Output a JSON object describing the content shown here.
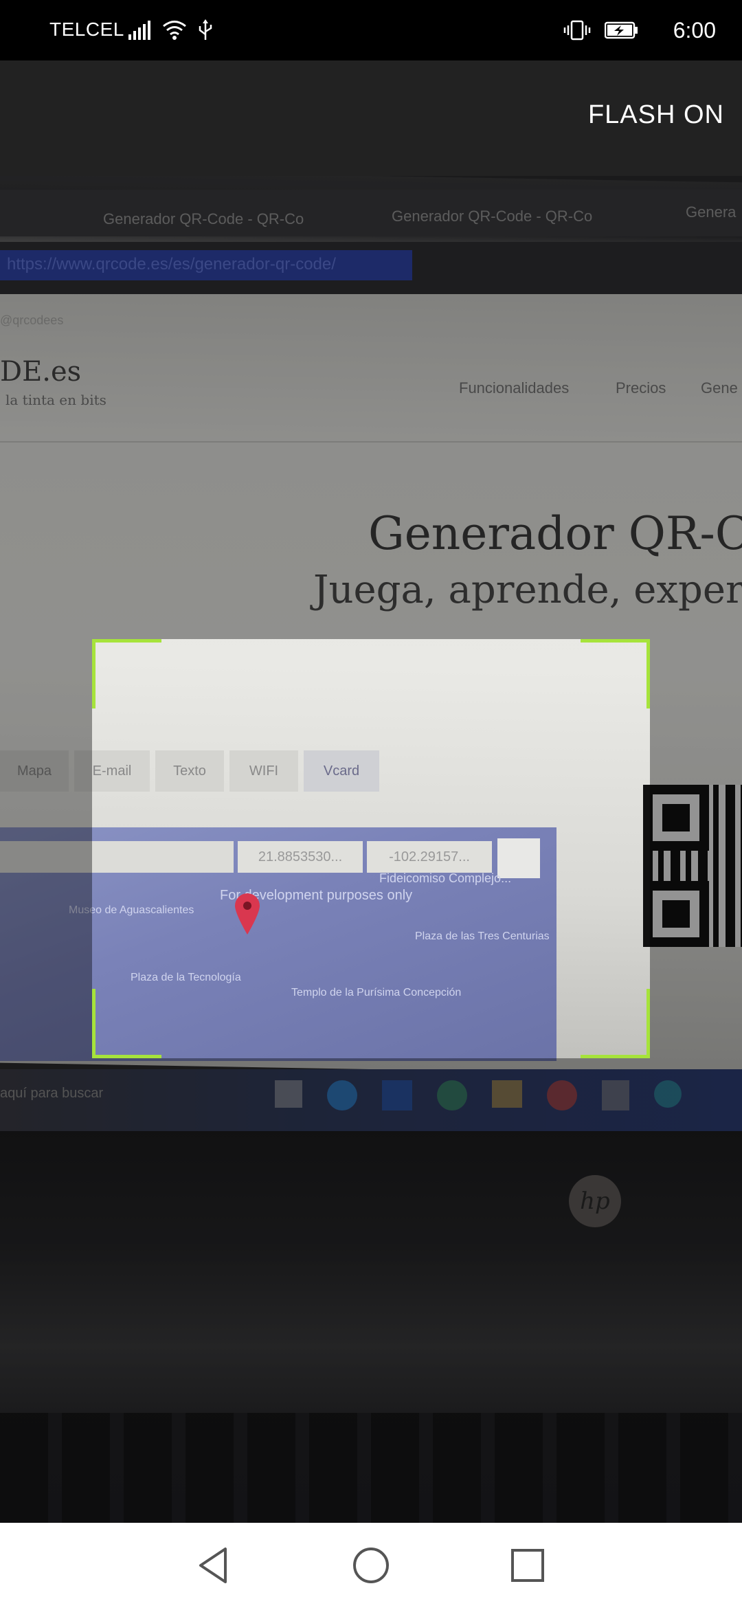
{
  "status_bar": {
    "carrier": "TELCEL",
    "time": "6:00",
    "icons": [
      "signal-icon",
      "wifi-icon",
      "usb-icon",
      "vibrate-icon",
      "battery-charging-icon"
    ]
  },
  "app_bar": {
    "flash_label": "FLASH ON"
  },
  "camera_scene": {
    "browser_tabs": [
      "Generador QR-Code - QR-Co",
      "Generador QR-Code - QR-Co",
      "Genera"
    ],
    "url": "https://www.qrcode.es/es/generador-qr-code/",
    "bookmark": "@qrcodees",
    "site_logo": "DE.es",
    "site_tagline": "la tinta en bits",
    "nav_links": [
      "Funcionalidades",
      "Precios",
      "Gene"
    ],
    "heading": "Generador QR-C",
    "subheading": "Juega, aprende, exper",
    "tabs": [
      "Mapa",
      "E-mail",
      "Texto",
      "WIFI",
      "Vcard"
    ],
    "lat": "21.8853530...",
    "lng": "-102.29157...",
    "map_labels": [
      "For development purposes only",
      "Fideicomiso Complejo...",
      "Plaza de las Tres Centurias",
      "Plaza de la Tecnología",
      "Templo de la Purísima Concepción",
      "Museo de Aguascalientes"
    ],
    "taskbar_search": "aquí para buscar",
    "laptop_brand": "hp"
  },
  "nav_bar": {
    "buttons": [
      "back",
      "home",
      "recents"
    ]
  },
  "colors": {
    "viewfinder_accent": "#a6e33b",
    "appbar_bg": "#222222"
  }
}
